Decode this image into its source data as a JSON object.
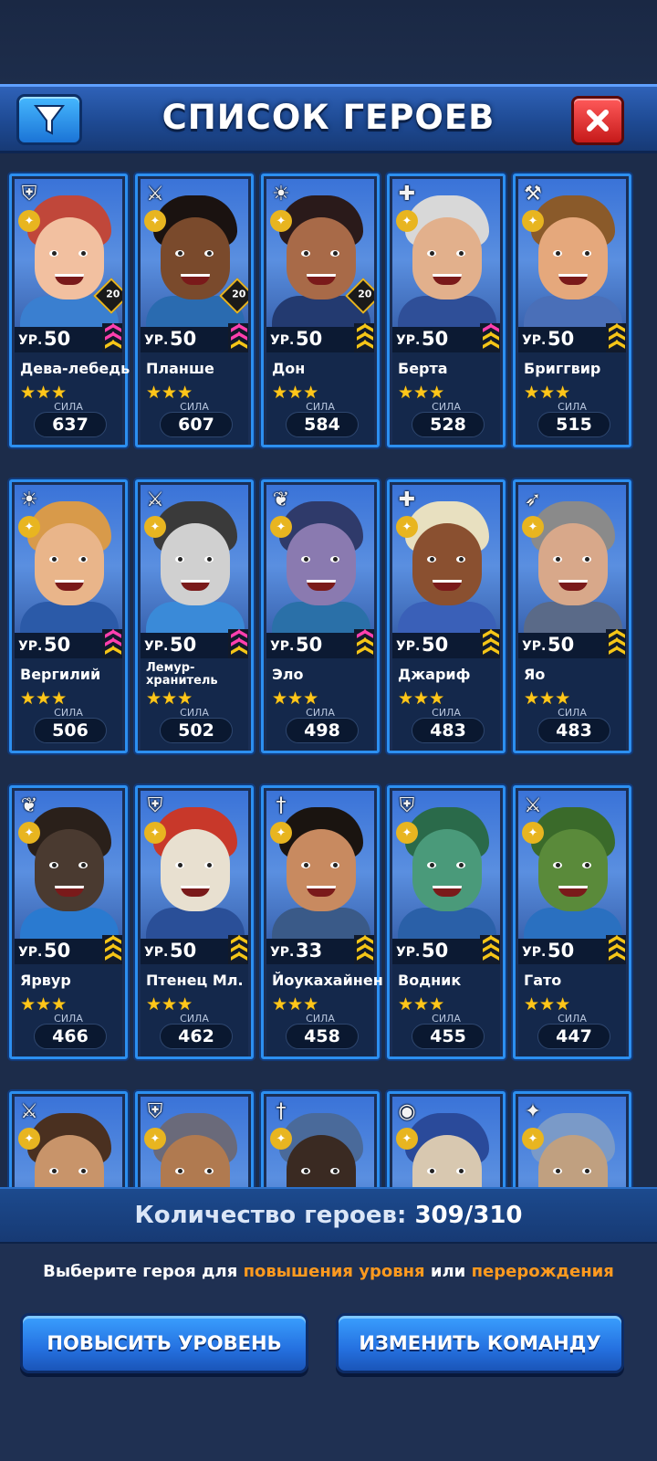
{
  "header": {
    "title": "СПИСОК ГЕРОЕВ",
    "filter_icon": "filter-funnel-icon",
    "close_icon": "close-x-icon"
  },
  "labels": {
    "level_prefix": "УР.",
    "power_label": "СИЛА",
    "stars": "★★★"
  },
  "colors": {
    "rank_gold": "#f5c517",
    "rank_pink": "#ff3fae",
    "highlight_orange": "#ff9a1f",
    "card_border": "#2c8ff0"
  },
  "heroes": [
    {
      "name": "Дева-лебедь",
      "level": "50",
      "power": "637",
      "class_icon": "shield-icon",
      "class_glyph": "⛨",
      "badge": "20",
      "rank": [
        "pink",
        "pink",
        "gold"
      ],
      "skin": "#f2c0a0",
      "hair": "#c0473a",
      "cloth": "#3a7fd0"
    },
    {
      "name": "Планше",
      "level": "50",
      "power": "607",
      "class_icon": "swords-icon",
      "class_glyph": "⚔",
      "badge": "20",
      "rank": [
        "pink",
        "pink",
        "gold"
      ],
      "skin": "#7a4a2c",
      "hair": "#1a1210",
      "cloth": "#2a6bb0"
    },
    {
      "name": "Дон",
      "level": "50",
      "power": "584",
      "class_icon": "sun-icon",
      "class_glyph": "☀",
      "badge": "20",
      "rank": [
        "gold",
        "gold",
        "gold"
      ],
      "skin": "#a86a48",
      "hair": "#2a1a1a",
      "cloth": "#233a70"
    },
    {
      "name": "Берта",
      "level": "50",
      "power": "528",
      "class_icon": "book-icon",
      "class_glyph": "✚",
      "badge": "",
      "rank": [
        "pink",
        "gold",
        "gold"
      ],
      "skin": "#e2b08c",
      "hair": "#d8d8d8",
      "cloth": "#2f4f98"
    },
    {
      "name": "Бриггвир",
      "level": "50",
      "power": "515",
      "class_icon": "axe-icon",
      "class_glyph": "⚒",
      "badge": "",
      "rank": [
        "gold",
        "gold",
        "gold"
      ],
      "skin": "#e5a87c",
      "hair": "#8a5a2a",
      "cloth": "#4a6fb8"
    },
    {
      "name": "Вергилий",
      "level": "50",
      "power": "506",
      "class_icon": "sun-icon",
      "class_glyph": "☀",
      "badge": "",
      "rank": [
        "pink",
        "pink",
        "gold"
      ],
      "skin": "#e9b58a",
      "hair": "#d89a4a",
      "cloth": "#2b5aa8"
    },
    {
      "name": "Лемур-хранитель",
      "level": "50",
      "power": "502",
      "class_icon": "swords-icon",
      "class_glyph": "⚔",
      "badge": "",
      "rank": [
        "pink",
        "pink",
        "gold"
      ],
      "skin": "#d0d0d0",
      "hair": "#3a3a3a",
      "cloth": "#3a8ad8"
    },
    {
      "name": "Эло",
      "level": "50",
      "power": "498",
      "class_icon": "feather-icon",
      "class_glyph": "❦",
      "badge": "",
      "rank": [
        "pink",
        "gold",
        "gold"
      ],
      "skin": "#8a7ab0",
      "hair": "#2f3a6a",
      "cloth": "#2a70a8"
    },
    {
      "name": "Джариф",
      "level": "50",
      "power": "483",
      "class_icon": "book-icon",
      "class_glyph": "✚",
      "badge": "",
      "rank": [
        "gold",
        "gold",
        "gold"
      ],
      "skin": "#8a5030",
      "hair": "#e8e0c0",
      "cloth": "#3a60b8"
    },
    {
      "name": "Яо",
      "level": "50",
      "power": "483",
      "class_icon": "bow-icon",
      "class_glyph": "➶",
      "badge": "",
      "rank": [
        "gold",
        "gold",
        "gold"
      ],
      "skin": "#d8a88a",
      "hair": "#8a8a8a",
      "cloth": "#5a6a88"
    },
    {
      "name": "Ярвур",
      "level": "50",
      "power": "466",
      "class_icon": "feather-icon",
      "class_glyph": "❦",
      "badge": "",
      "rank": [
        "gold",
        "gold",
        "gold"
      ],
      "skin": "#4a3a30",
      "hair": "#2a201a",
      "cloth": "#2a7ad0"
    },
    {
      "name": "Птенец Мл.",
      "level": "50",
      "power": "462",
      "class_icon": "shield-icon",
      "class_glyph": "⛨",
      "badge": "",
      "rank": [
        "gold",
        "gold",
        "gold"
      ],
      "skin": "#e8e0d0",
      "hair": "#c8382a",
      "cloth": "#2a4f98"
    },
    {
      "name": "Йоукахайнен",
      "level": "33",
      "power": "458",
      "class_icon": "dagger-icon",
      "class_glyph": "†",
      "badge": "",
      "rank": [
        "gold",
        "gold",
        "gold"
      ],
      "skin": "#c88a60",
      "hair": "#1a1410",
      "cloth": "#3a5a88"
    },
    {
      "name": "Водник",
      "level": "50",
      "power": "455",
      "class_icon": "shield-icon",
      "class_glyph": "⛨",
      "badge": "",
      "rank": [
        "gold",
        "gold",
        "gold"
      ],
      "skin": "#4a9a7a",
      "hair": "#2a6a4a",
      "cloth": "#2a60a8"
    },
    {
      "name": "Гато",
      "level": "50",
      "power": "447",
      "class_icon": "swords-icon",
      "class_glyph": "⚔",
      "badge": "",
      "rank": [
        "gold",
        "gold",
        "gold"
      ],
      "skin": "#5a8a3a",
      "hair": "#3a6a2a",
      "cloth": "#2a70c0"
    },
    {
      "name": "",
      "level": "",
      "power": "",
      "class_icon": "swords-icon",
      "class_glyph": "⚔",
      "badge": "",
      "rank": [],
      "skin": "#c8946a",
      "hair": "#4a3020",
      "cloth": "#3a6ac0"
    },
    {
      "name": "",
      "level": "",
      "power": "",
      "class_icon": "shield-icon",
      "class_glyph": "⛨",
      "badge": "",
      "rank": [],
      "skin": "#b07a50",
      "hair": "#6a6a7a",
      "cloth": "#3a6ac0"
    },
    {
      "name": "",
      "level": "",
      "power": "",
      "class_icon": "dagger-icon",
      "class_glyph": "†",
      "badge": "",
      "rank": [],
      "skin": "#3a2a22",
      "hair": "#4a6a9a",
      "cloth": "#3a6ac0"
    },
    {
      "name": "",
      "level": "",
      "power": "",
      "class_icon": "mask-icon",
      "class_glyph": "◉",
      "badge": "",
      "rank": [],
      "skin": "#d8c8b0",
      "hair": "#2a4a9a",
      "cloth": "#3a6ac0"
    },
    {
      "name": "",
      "level": "",
      "power": "",
      "class_icon": "staff-icon",
      "class_glyph": "✦",
      "badge": "",
      "rank": [],
      "skin": "#c0a080",
      "hair": "#7a9ac8",
      "cloth": "#3a6ac0"
    }
  ],
  "footer": {
    "count_label": "Количество героев:",
    "count_value": "309/310",
    "hint_prefix": "Выберите героя для",
    "hint_level": "повышения уровня",
    "hint_or": "или",
    "hint_rebirth": "перерождения",
    "btn_level_up": "ПОВЫСИТЬ УРОВЕНЬ",
    "btn_change_team": "ИЗМЕНИТЬ КОМАНДУ"
  }
}
